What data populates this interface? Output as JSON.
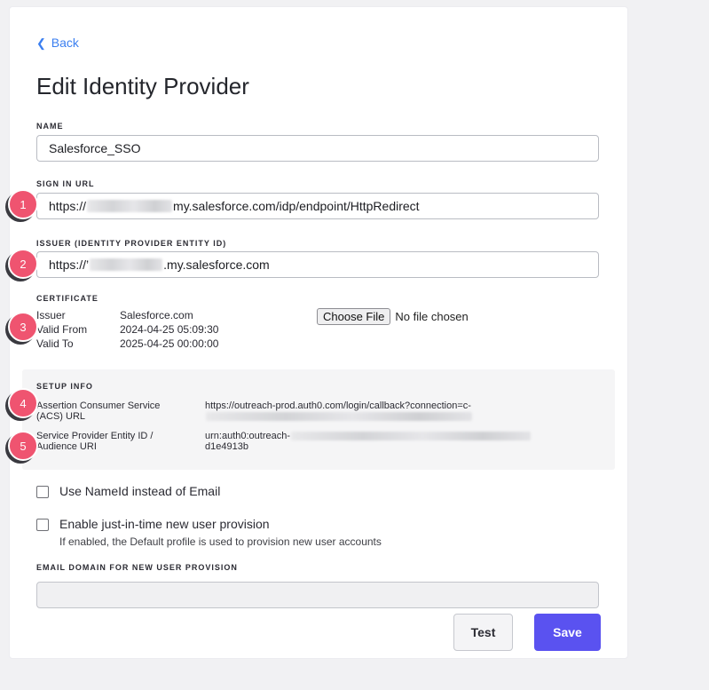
{
  "nav": {
    "back_label": "Back"
  },
  "page": {
    "title": "Edit Identity Provider"
  },
  "fields": {
    "name": {
      "label": "NAME",
      "value": "Salesforce_SSO"
    },
    "sign_in_url": {
      "label": "SIGN IN URL",
      "prefix": "https://",
      "suffix": "my.salesforce.com/idp/endpoint/HttpRedirect"
    },
    "issuer": {
      "label": "ISSUER (IDENTITY PROVIDER ENTITY ID)",
      "prefix": "https://’",
      "suffix": ".my.salesforce.com"
    }
  },
  "certificate": {
    "label": "CERTIFICATE",
    "rows": [
      {
        "key": "Issuer",
        "value": "Salesforce.com"
      },
      {
        "key": "Valid From",
        "value": "2024-04-25 05:09:30"
      },
      {
        "key": "Valid To",
        "value": "2025-04-25 00:00:00"
      }
    ],
    "file_button": "Choose File",
    "file_status": "No file chosen"
  },
  "setup_info": {
    "label": "SETUP INFO",
    "rows": [
      {
        "key": "Assertion Consumer Service (ACS) URL",
        "value": "https://outreach-prod.auth0.com/login/callback?connection=c-"
      },
      {
        "key": "Service Provider Entity ID / Audience URI",
        "value_prefix": "urn:auth0:outreach-",
        "value_suffix": "d1e4913b"
      }
    ]
  },
  "options": {
    "nameid": {
      "label": "Use NameId instead of Email",
      "checked": false
    },
    "jit": {
      "label": "Enable just-in-time new user provision",
      "hint": "If enabled, the Default profile is used to provision new user accounts",
      "checked": false
    }
  },
  "email_domain": {
    "label": "EMAIL DOMAIN FOR NEW USER PROVISION",
    "value": ""
  },
  "buttons": {
    "test": "Test",
    "save": "Save"
  },
  "badges": [
    "1",
    "2",
    "3",
    "4",
    "5"
  ],
  "colors": {
    "accent": "#5a52f0",
    "link": "#3b7ff0",
    "badge": "#ef5470"
  }
}
